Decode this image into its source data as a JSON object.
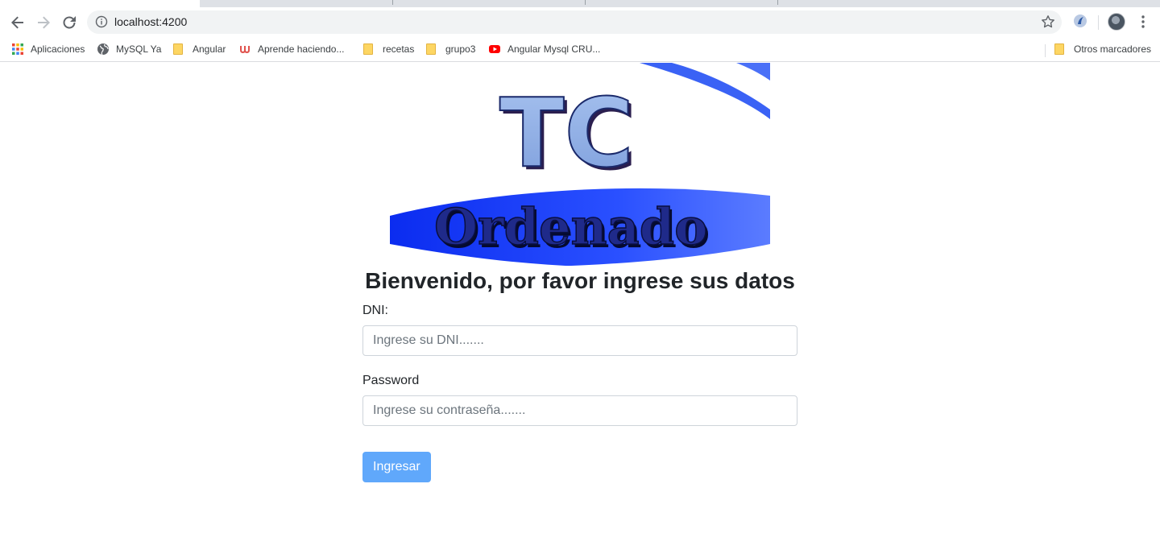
{
  "browser": {
    "url": "localhost:4200",
    "bookmarks": [
      {
        "label": "Aplicaciones",
        "icon": "apps-grid-icon"
      },
      {
        "label": "MySQL Ya",
        "icon": "globe-icon"
      },
      {
        "label": "Angular",
        "icon": "folder-icon"
      },
      {
        "label": "Aprende haciendo...",
        "icon": "udemy-icon"
      },
      {
        "label": "recetas",
        "icon": "folder-icon"
      },
      {
        "label": "grupo3",
        "icon": "folder-icon"
      },
      {
        "label": "Angular Mysql CRU...",
        "icon": "youtube-icon"
      }
    ],
    "other_bookmarks": "Otros marcadores"
  },
  "page": {
    "logo": {
      "line1": "TC",
      "line2": "Ordenado"
    },
    "welcome": "Bienvenido, por favor ingrese sus datos",
    "form": {
      "dni_label": "DNI:",
      "dni_placeholder": "Ingrese su DNI.......",
      "password_label": "Password",
      "password_placeholder": "Ingrese su contraseña.......",
      "submit_label": "Ingresar"
    }
  },
  "colors": {
    "button": "#60a8fb",
    "logo_blue": "#1a3cff",
    "logo_letters": "#8fb1e8"
  }
}
